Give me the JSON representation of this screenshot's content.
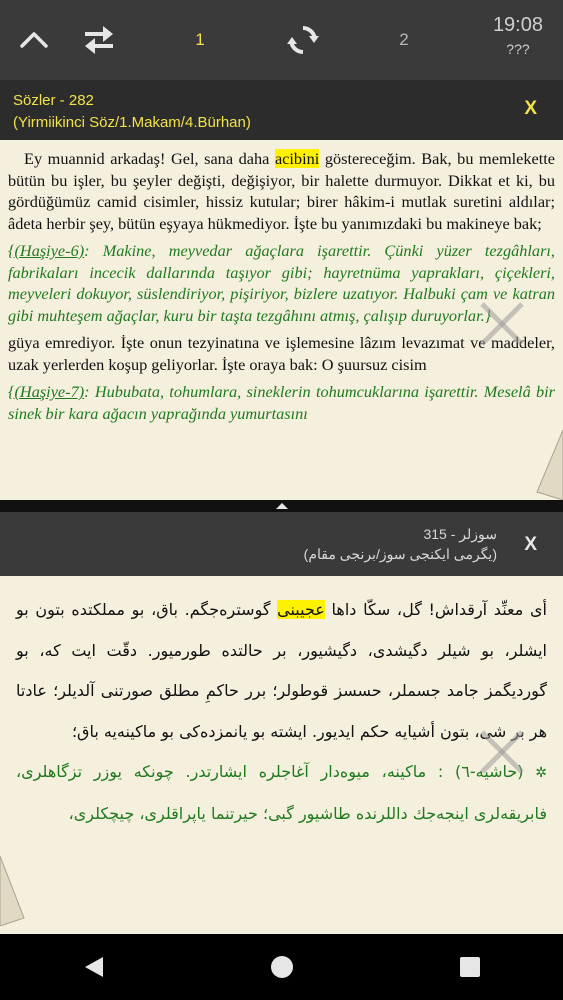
{
  "toolbar": {
    "active_page": "1",
    "other_page": "2",
    "time": "19:08",
    "battery": "???"
  },
  "latin_header": {
    "title": "Sözler - 282",
    "subtitle": "(Yirmiikinci Söz/1.Makam/4.Bürhan)",
    "close_label": "X"
  },
  "latin_text": {
    "p1_before": "Ey muannid arkadaş! Gel, sana daha ",
    "p1_highlight": "acibini",
    "p1_after": " göstereceğim. Bak, bu memlekette bütün bu işler, bu şeyler değişti, değişiyor, bir halette durmuyor. Dikkat et ki, bu gördüğümüz camid cisimler, hissiz kutular; birer hâkim-i mutlak suretini aldılar; âdeta herbir şey, bütün eşyaya hükmediyor. İşte bu yanımızdaki bu makineye bak;",
    "note6_ref": "{(Haşiye-6)",
    "note6_text": ": Makine, meyvedar ağaçlara işarettir. Çünki yüzer tezgâhları, fabrikaları incecik dallarında taşıyor gibi; hayretnüma yaprakları, çiçekleri, meyveleri dokuyor, süslendiriyor, pişiriyor, bizlere uzatıyor. Halbuki çam ve katran gibi muhteşem ağaçlar, kuru bir taşta tezgâhını atmış, çalışıp duruyorlar.}",
    "p2": "güya emrediyor. İşte onun tezyinatına ve işlemesine lâzım levazımat ve maddeler, uzak yerlerden koşup geliyorlar. İşte oraya bak: O şuursuz cisim",
    "note7_ref": "{(Haşiye-7)",
    "note7_text": ": Hububata, tohumlara, sineklerin tohumcuklarına işarettir. Meselâ bir sinek bir kara ağacın yaprağında yumurtasını"
  },
  "ottoman_header": {
    "title": "سوزلر - 315",
    "subtitle": "(يگرمى ايكنجى سوز/برنجى مقام)",
    "close_label": "X"
  },
  "ottoman_text": {
    "before": "أى معنِّد آرقداش! گل، سكّا داها ",
    "highlight": "عجيبنى",
    "after": " گوستره‌جگم. باق، بو مملكتده بتون بو ايشلر، بو شيلر دگيشدى، دگيشيور، بر حالتده طورميور. دقّت ايت كه، بو گورديگمز جامد جسملر، حسسز قوطولر؛ برر حاكمِ مطلق صورتنى آلديلر؛ عادتا هر بر شى، بتون أشيايه حكم ايديور. ايشته بو يانمزده‌كى بو ماكينه‌يه باق؛",
    "note": "(حاشيه-٦) : ماكينه، ميوه‌دار آغاجلره ايشارتدر. چونكه يوزر تزگاهلرى، فابريقه‌لرى اينجه‌جك داللرنده طاشيور گبى؛ حيرتنما ياپراقلرى، چيچكلرى،"
  },
  "colors": {
    "accent_yellow": "#f2e24a",
    "highlight": "#fff200",
    "note_green": "#1f7a1f",
    "paper": "#f5efdd"
  }
}
